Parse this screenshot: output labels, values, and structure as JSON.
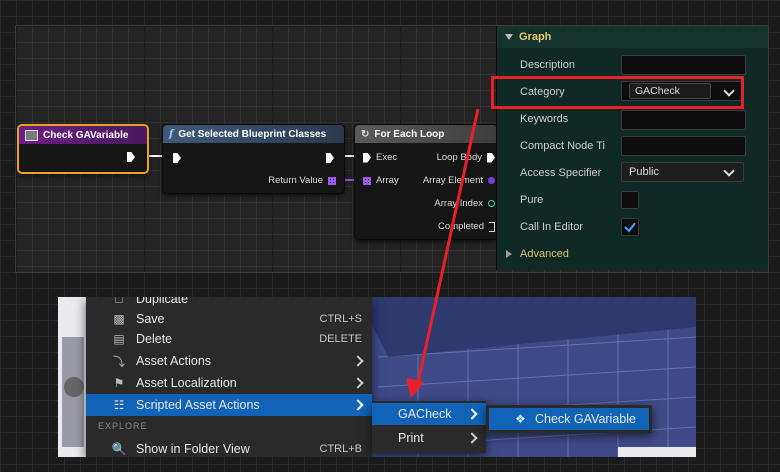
{
  "blueprint": {
    "node_check": {
      "title": "Check GAVariable"
    },
    "node_get": {
      "title": "Get Selected Blueprint Classes",
      "icon": "f",
      "return_label": "Return Value"
    },
    "node_loop": {
      "title": "For Each Loop",
      "exec": "Exec",
      "array": "Array",
      "loop_body": "Loop Body",
      "array_element": "Array Element",
      "array_index": "Array Index",
      "completed": "Completed"
    }
  },
  "details": {
    "section": "Graph",
    "rows": {
      "description": "Description",
      "category": "Category",
      "category_value": "GACheck",
      "keywords": "Keywords",
      "compact": "Compact Node Ti",
      "access": "Access Specifier",
      "access_value": "Public",
      "pure": "Pure",
      "call_in_editor": "Call In Editor"
    },
    "advanced": "Advanced"
  },
  "menu": {
    "items": [
      {
        "label": "Duplicate",
        "shortcut": "",
        "icon": "duplicate-icon"
      },
      {
        "label": "Save",
        "shortcut": "CTRL+S",
        "icon": "save-icon"
      },
      {
        "label": "Delete",
        "shortcut": "DELETE",
        "icon": "trash-icon"
      },
      {
        "label": "Asset Actions",
        "icon": "wrench-icon"
      },
      {
        "label": "Asset Localization",
        "icon": "flag-icon"
      },
      {
        "label": "Scripted Asset Actions",
        "icon": "script-icon"
      }
    ],
    "explore_heading": "EXPLORE",
    "folder_view": {
      "label": "Show in Folder View",
      "shortcut": "CTRL+B"
    }
  },
  "submenu": {
    "items": [
      "GACheck",
      "Print"
    ]
  },
  "submenu2": {
    "item": "Check GAVariable"
  },
  "colors": {
    "highlight": "#1163b8",
    "annotation": "#e8202a",
    "details_bg": "#0f2a24"
  }
}
